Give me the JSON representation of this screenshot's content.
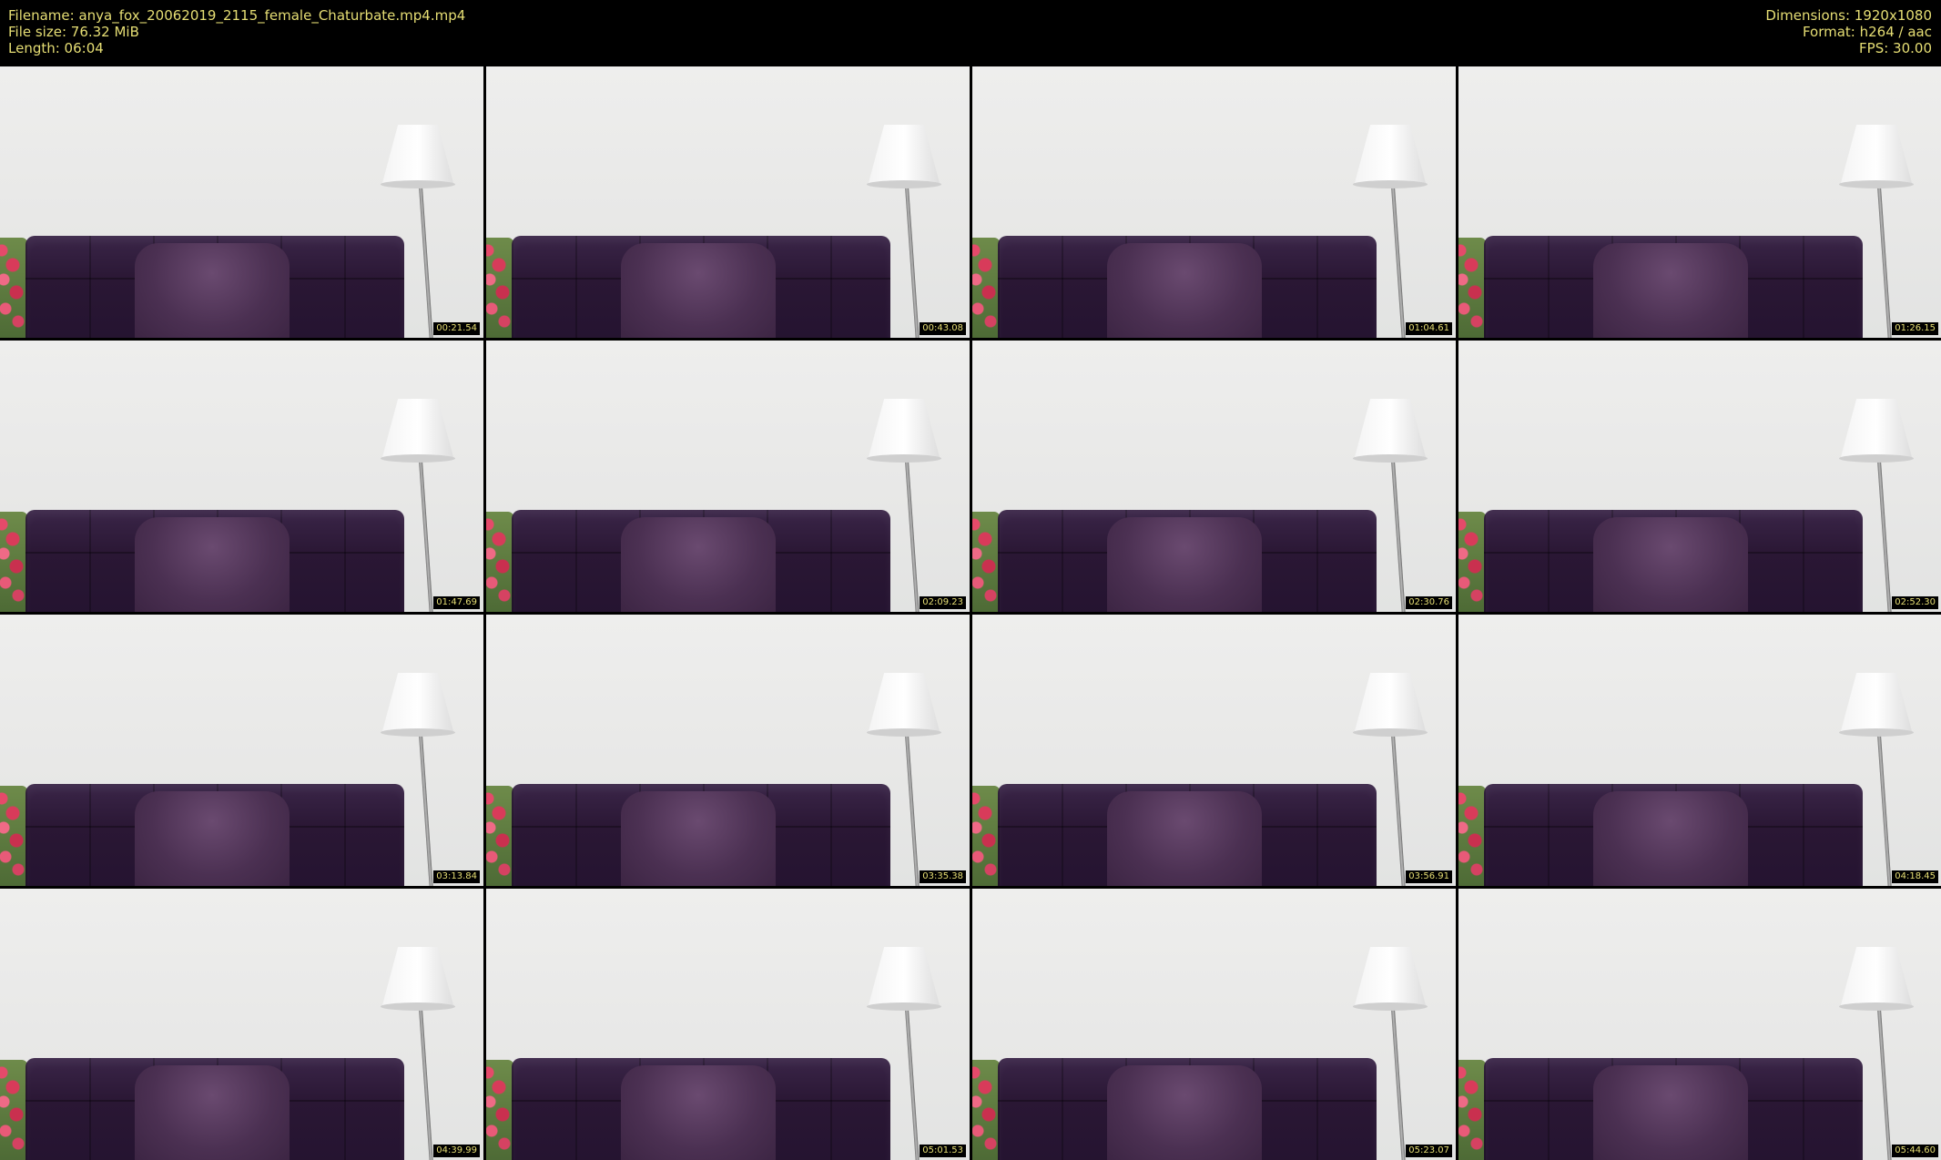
{
  "header": {
    "filename": "Filename: anya_fox_20062019_2115_female_Chaturbate.mp4.mp4",
    "filesize": "File size: 76.32 MiB",
    "length": "Length: 06:04",
    "dimensions": "Dimensions: 1920x1080",
    "format": "Format: h264 / aac",
    "fps": "FPS: 30.00"
  },
  "colors": {
    "header_background": "#000000",
    "text": "#e6de74"
  },
  "thumbnails": [
    {
      "timestamp": "00:21.54"
    },
    {
      "timestamp": "00:43.08"
    },
    {
      "timestamp": "01:04.61"
    },
    {
      "timestamp": "01:26.15"
    },
    {
      "timestamp": "01:47.69"
    },
    {
      "timestamp": "02:09.23"
    },
    {
      "timestamp": "02:30.76"
    },
    {
      "timestamp": "02:52.30"
    },
    {
      "timestamp": "03:13.84"
    },
    {
      "timestamp": "03:35.38"
    },
    {
      "timestamp": "03:56.91"
    },
    {
      "timestamp": "04:18.45"
    },
    {
      "timestamp": "04:39.99"
    },
    {
      "timestamp": "05:01.53"
    },
    {
      "timestamp": "05:23.07"
    },
    {
      "timestamp": "05:44.60"
    }
  ]
}
